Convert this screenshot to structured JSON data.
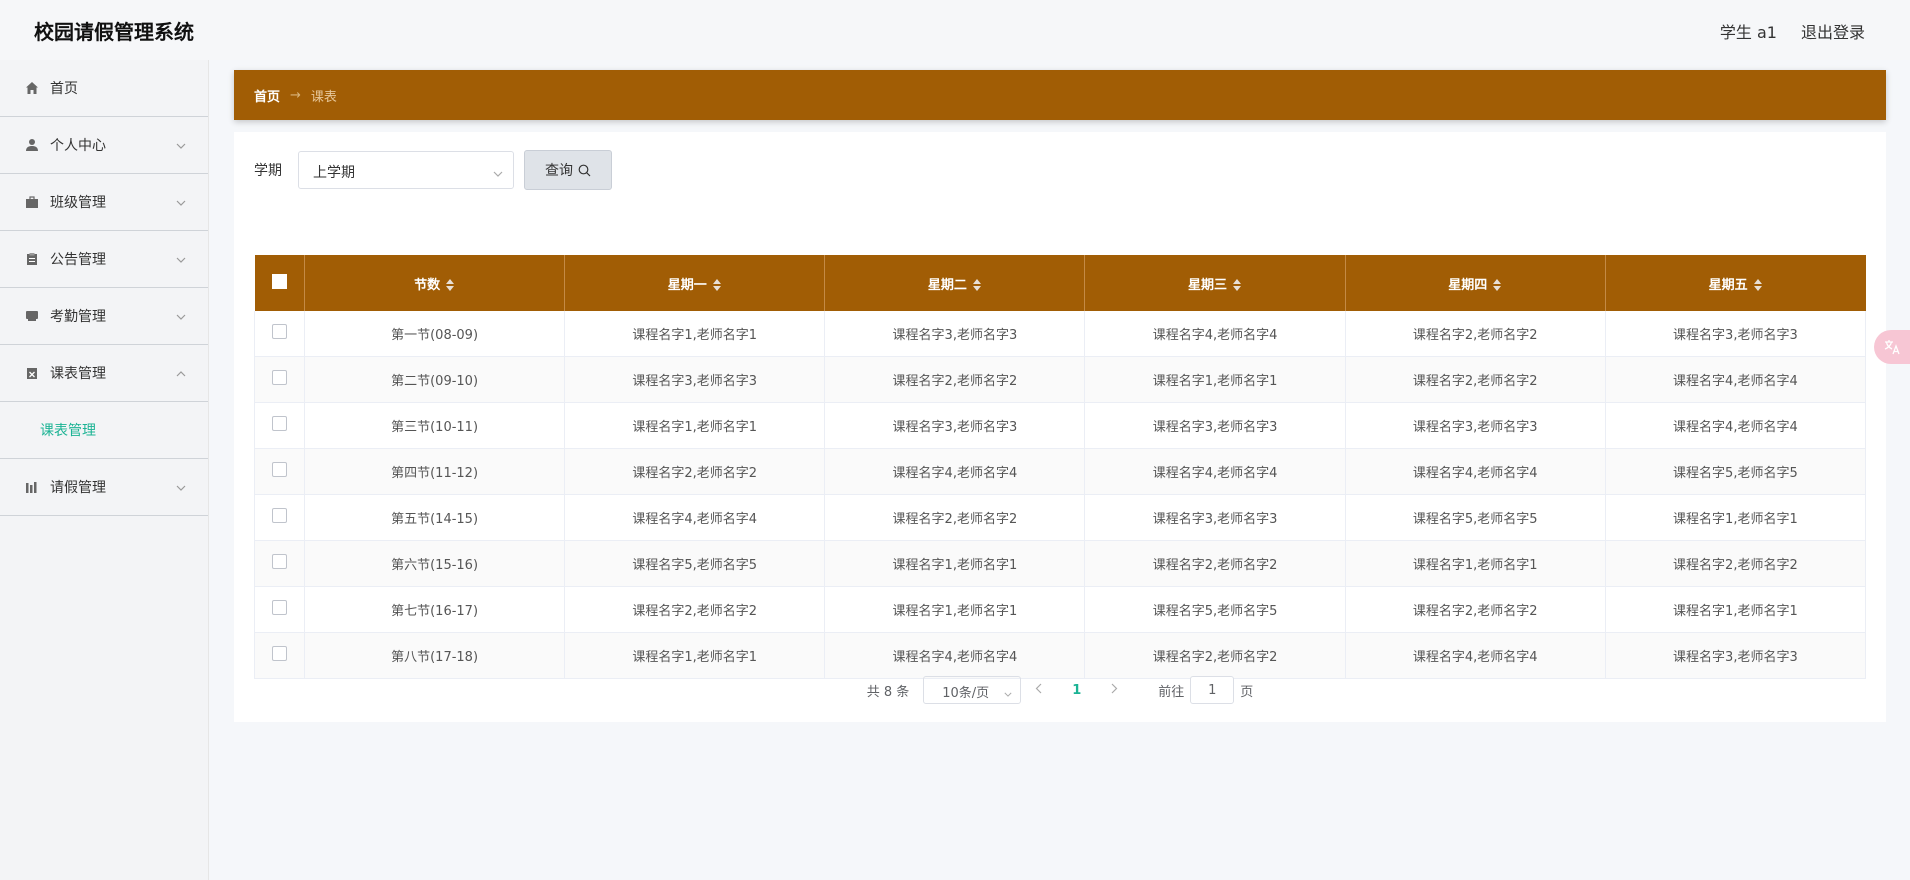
{
  "app": {
    "title": "校园请假管理系统",
    "user": "学生 a1",
    "logout": "退出登录"
  },
  "sidebar": {
    "items": [
      {
        "label": "首页",
        "icon": "home-icon"
      },
      {
        "label": "个人中心",
        "icon": "user-icon"
      },
      {
        "label": "班级管理",
        "icon": "briefcase-icon"
      },
      {
        "label": "公告管理",
        "icon": "clipboard-icon"
      },
      {
        "label": "考勤管理",
        "icon": "tray-icon"
      },
      {
        "label": "课表管理",
        "icon": "schedule-icon",
        "expanded": true
      },
      {
        "label": "请假管理",
        "icon": "chart-icon"
      }
    ],
    "submenu_label": "课表管理"
  },
  "breadcrumb": {
    "home": "首页",
    "separator": "→",
    "current": "课表"
  },
  "filter": {
    "label": "学期",
    "selected": "上学期",
    "query_label": "查询"
  },
  "table": {
    "headers": [
      "节数",
      "星期一",
      "星期二",
      "星期三",
      "星期四",
      "星期五"
    ],
    "rows": [
      [
        "第一节(08-09)",
        "课程名字1,老师名字1",
        "课程名字3,老师名字3",
        "课程名字4,老师名字4",
        "课程名字2,老师名字2",
        "课程名字3,老师名字3"
      ],
      [
        "第二节(09-10)",
        "课程名字3,老师名字3",
        "课程名字2,老师名字2",
        "课程名字1,老师名字1",
        "课程名字2,老师名字2",
        "课程名字4,老师名字4"
      ],
      [
        "第三节(10-11)",
        "课程名字1,老师名字1",
        "课程名字3,老师名字3",
        "课程名字3,老师名字3",
        "课程名字3,老师名字3",
        "课程名字4,老师名字4"
      ],
      [
        "第四节(11-12)",
        "课程名字2,老师名字2",
        "课程名字4,老师名字4",
        "课程名字4,老师名字4",
        "课程名字4,老师名字4",
        "课程名字5,老师名字5"
      ],
      [
        "第五节(14-15)",
        "课程名字4,老师名字4",
        "课程名字2,老师名字2",
        "课程名字3,老师名字3",
        "课程名字5,老师名字5",
        "课程名字1,老师名字1"
      ],
      [
        "第六节(15-16)",
        "课程名字5,老师名字5",
        "课程名字1,老师名字1",
        "课程名字2,老师名字2",
        "课程名字1,老师名字1",
        "课程名字2,老师名字2"
      ],
      [
        "第七节(16-17)",
        "课程名字2,老师名字2",
        "课程名字1,老师名字1",
        "课程名字5,老师名字5",
        "课程名字2,老师名字2",
        "课程名字1,老师名字1"
      ],
      [
        "第八节(17-18)",
        "课程名字1,老师名字1",
        "课程名字4,老师名字4",
        "课程名字2,老师名字2",
        "课程名字4,老师名字4",
        "课程名字3,老师名字3"
      ]
    ]
  },
  "pagination": {
    "total": "共 8 条",
    "page_size": "10条/页",
    "current": "1",
    "goto_label": "前往",
    "goto_value": "1",
    "page_suffix": "页"
  },
  "colors": {
    "accent": "#a15d05",
    "active_text": "#1bb394"
  }
}
